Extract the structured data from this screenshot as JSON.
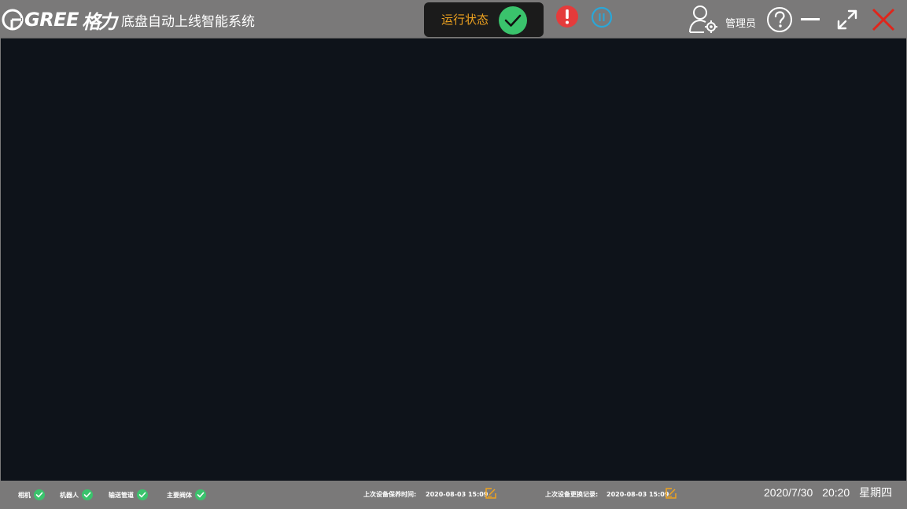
{
  "header": {
    "brand": "GREE",
    "brand_script": "格力",
    "title": "底盘自动上线智能系统",
    "status_label": "运行状态",
    "user_label": "管理员"
  },
  "footer": {
    "devices": [
      {
        "label": "相机",
        "status": "ok"
      },
      {
        "label": "机器人",
        "status": "ok"
      },
      {
        "label": "输送管道",
        "status": "ok"
      },
      {
        "label": "主要阀体",
        "status": "ok"
      }
    ],
    "maintenance_label": "上次设备保养时间:",
    "maintenance_time": "2020-08-03  15:09",
    "replace_label": "上次设备更换记录:",
    "replace_time": "2020-08-03  15:09",
    "date": "2020/7/30",
    "time": "20:20",
    "weekday": "星期四"
  },
  "colors": {
    "accent_orange": "#f0a31f",
    "ok_green": "#3ac36c",
    "alarm_red": "#e43b3b",
    "pause_blue": "#2aa7d8",
    "close_red": "#e0251b"
  }
}
